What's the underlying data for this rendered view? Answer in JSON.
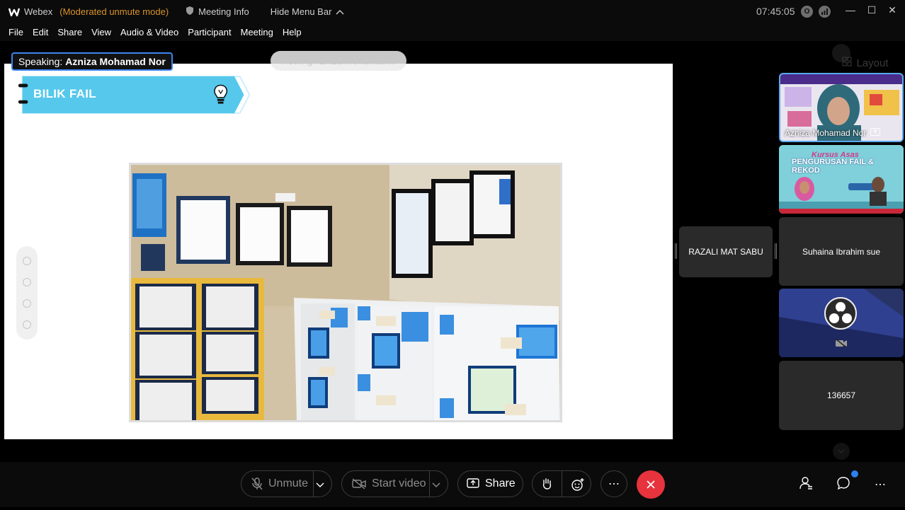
{
  "titlebar": {
    "app_name": "Webex",
    "status": "(Moderated unmute mode)",
    "meeting_info": "Meeting Info",
    "hide_menu": "Hide Menu Bar",
    "clock": "07:45:05",
    "badge": "O"
  },
  "menu": [
    "File",
    "Edit",
    "Share",
    "View",
    "Audio & Video",
    "Participant",
    "Meeting",
    "Help"
  ],
  "stage": {
    "speaking_label": "Speaking:",
    "speaking_name": "Azniza Mohamad Nor",
    "viewing_text": "Viewing Azniza Mohamad ...",
    "slide_title": "BILIK FAIL"
  },
  "panel": {
    "layout_label": "Layout",
    "tiles": [
      {
        "name": "Azniza Mohamad Nor",
        "active": true
      },
      {
        "name": "",
        "banner_title": "PENGURUSAN FAIL & REKOD",
        "banner_sub": "Kursus Asas"
      },
      {
        "name": "Suhaina Ibrahim sue"
      },
      {
        "name": ""
      },
      {
        "name": "136657"
      }
    ],
    "side_participant": "RAZALI MAT SABU"
  },
  "controls": {
    "unmute": "Unmute",
    "start_video": "Start video",
    "share": "Share"
  },
  "colors": {
    "accent": "#3c84f0",
    "end_call": "#e6333d",
    "banner": "#55c8ec",
    "status_orange": "#d9932b",
    "notification": "#2d7ff0"
  }
}
